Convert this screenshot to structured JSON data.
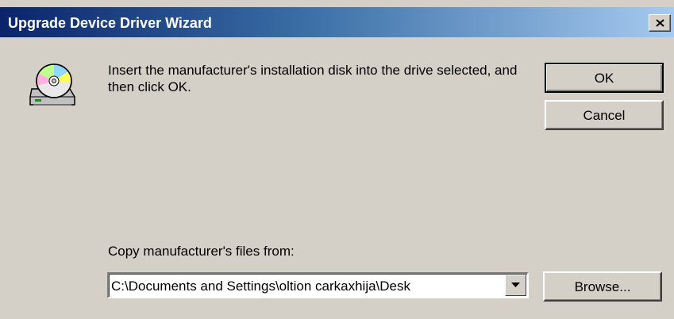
{
  "window": {
    "title": "Upgrade Device Driver Wizard",
    "close_symbol": "×"
  },
  "message": {
    "icon": "disk-drive-icon",
    "text": "Insert the manufacturer's installation disk into the drive selected, and then click OK."
  },
  "buttons": {
    "ok": "OK",
    "cancel": "Cancel",
    "browse": "Browse..."
  },
  "copy_from": {
    "label": "Copy manufacturer's files from:",
    "value": "C:\\Documents and Settings\\oltion carkaxhija\\Desk"
  },
  "colors": {
    "title_gradient_start": "#0a246a",
    "title_gradient_end": "#a6caf0",
    "dialog_face": "#d4d0c8"
  }
}
